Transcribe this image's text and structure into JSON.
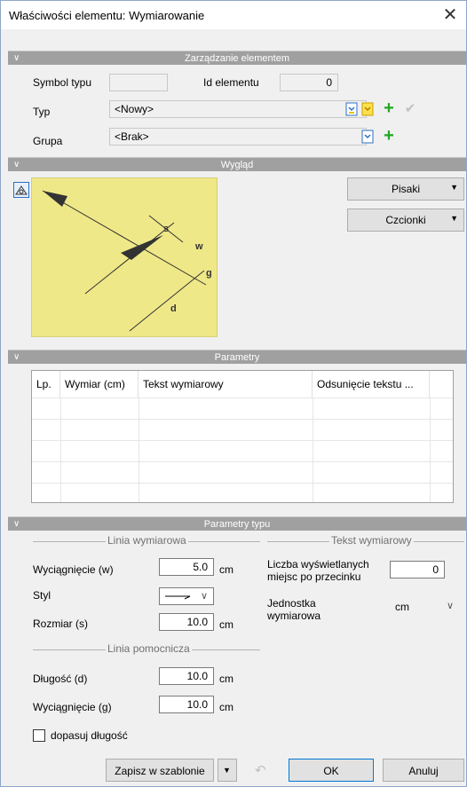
{
  "window": {
    "title": "Właściwości elementu: Wymiarowanie"
  },
  "section_manage": {
    "title": "Zarządzanie elementem"
  },
  "manage": {
    "symbol_label": "Symbol typu",
    "symbol_value": "",
    "id_label": "Id elementu",
    "id_value": "0",
    "typ_label": "Typ",
    "typ_value": "<Nowy>",
    "grupa_label": "Grupa",
    "grupa_value": "<Brak>"
  },
  "section_look": {
    "title": "Wygląd"
  },
  "look": {
    "pisaki_label": "Pisaki",
    "czcionki_label": "Czcionki",
    "diagram_labels": {
      "s": "s",
      "w": "w",
      "g": "g",
      "d": "d"
    }
  },
  "section_params": {
    "title": "Parametry"
  },
  "params_table": {
    "columns": [
      "Lp.",
      "Wymiar (cm)",
      "Tekst wymiarowy",
      "Odsunięcie tekstu ..."
    ]
  },
  "section_type_params": {
    "title": "Parametry typu"
  },
  "type_params": {
    "linia_wymiarowa_label": "Linia wymiarowa",
    "wyciagniecie_w_label": "Wyciągnięcie (w)",
    "wyciagniecie_w_value": "5.0",
    "styl_label": "Styl",
    "rozmiar_label": "Rozmiar (s)",
    "rozmiar_value": "10.0",
    "linia_pomocnicza_label": "Linia pomocnicza",
    "dlugosc_label": "Długość (d)",
    "dlugosc_value": "10.0",
    "wyciagniecie_g_label": "Wyciągnięcie (g)",
    "wyciagniecie_g_value": "10.0",
    "dopasuj_label": "dopasuj długość",
    "tekst_wymiarowy_label": "Tekst wymiarowy",
    "liczba_label_1": "Liczba wyświetlanych",
    "liczba_label_2": "miejsc po przecinku",
    "liczba_value": "0",
    "jednostka_label_1": "Jednostka",
    "jednostka_label_2": "wymiarowa",
    "jednostka_value": "cm",
    "unit": "cm"
  },
  "footer": {
    "zapisz_label": "Zapisz w szablonie",
    "ok_label": "OK",
    "anuluj_label": "Anuluj"
  }
}
